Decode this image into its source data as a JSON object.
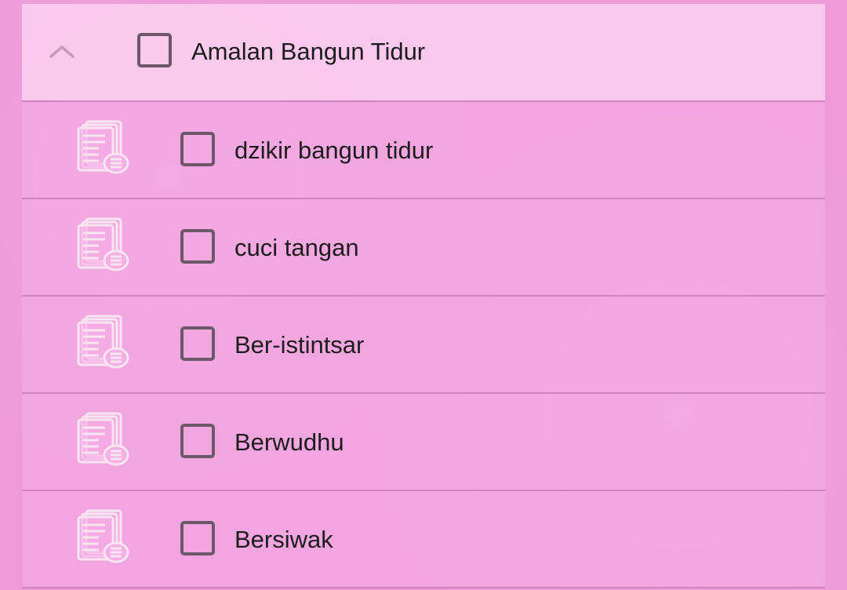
{
  "group": {
    "title": "Amalan Bangun Tidur",
    "expand_icon": "chevron-up-icon"
  },
  "items": [
    {
      "label": "dzikir bangun tidur",
      "icon": "document-list-icon",
      "checked": false
    },
    {
      "label": "cuci tangan",
      "icon": "document-list-icon",
      "checked": false
    },
    {
      "label": "Ber-istintsar",
      "icon": "document-list-icon",
      "checked": false
    },
    {
      "label": "Berwudhu",
      "icon": "document-list-icon",
      "checked": false
    },
    {
      "label": "Bersiwak",
      "icon": "document-list-icon",
      "checked": false
    }
  ],
  "colors": {
    "background": "#ee9ad9",
    "header_row": "#fbd6f2",
    "row": "#f6aee5",
    "divider": "#cf84c0",
    "checkbox_border": "#6c5868",
    "text": "#1d1d1d"
  }
}
